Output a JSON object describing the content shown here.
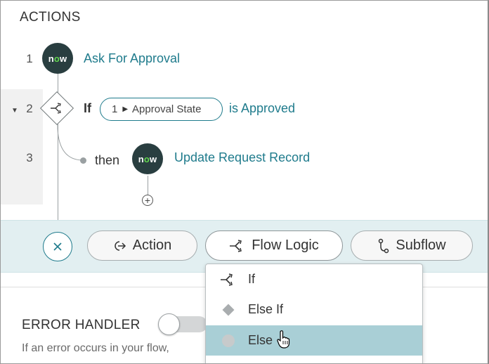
{
  "actions": {
    "title": "ACTIONS",
    "steps": [
      {
        "number": "1",
        "badge": "now",
        "label": "Ask For Approval"
      },
      {
        "number": "2",
        "if_label": "If",
        "condition_ref": "1",
        "condition_field": "Approval State",
        "condition_op": "is Approved"
      },
      {
        "number": "3",
        "then_label": "then",
        "badge": "now",
        "label": "Update Request Record"
      }
    ]
  },
  "add_bar": {
    "buttons": [
      {
        "label": "Action",
        "icon": "action-arrow-icon"
      },
      {
        "label": "Flow Logic",
        "icon": "flow-logic-icon"
      },
      {
        "label": "Subflow",
        "icon": "subflow-icon"
      }
    ]
  },
  "flow_logic_menu": {
    "items": [
      {
        "label": "If",
        "icon": "if-branch-icon"
      },
      {
        "label": "Else If",
        "icon": "diamond-icon"
      },
      {
        "label": "Else",
        "icon": "circle-icon",
        "highlighted": true
      }
    ]
  },
  "error_handler": {
    "title": "ERROR HANDLER",
    "description": "If an error occurs in your flow,"
  },
  "colors": {
    "accent": "#1f7b8c",
    "now_badge": "#293e40",
    "now_o": "#62d84e",
    "add_bar_bg": "#e2eff1",
    "menu_highlight": "#a9cfd6"
  }
}
